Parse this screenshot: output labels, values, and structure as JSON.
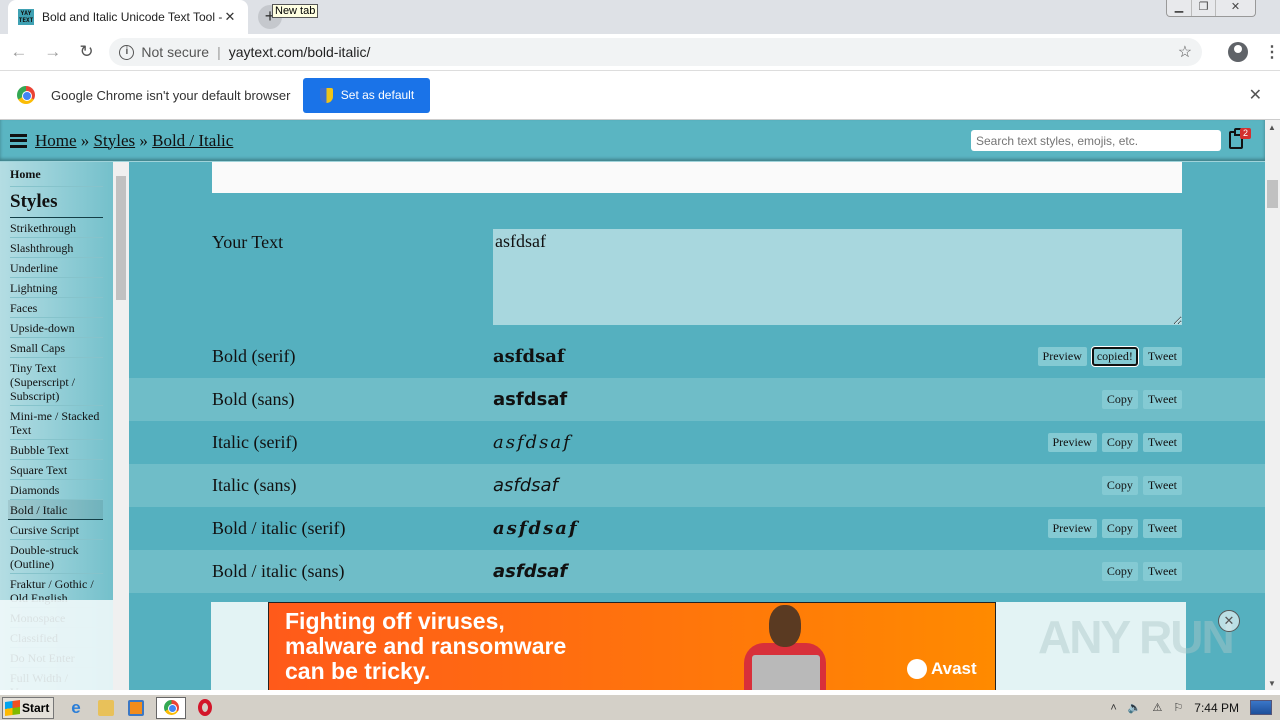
{
  "browser": {
    "tab_title": "Bold and Italic Unicode Text Tool - B",
    "favicon_text": "YAY TEXT",
    "new_tab_tooltip": "New tab",
    "security_label": "Not secure",
    "url": "yaytext.com/bold-italic/",
    "infobar_text": "Google Chrome isn't your default browser",
    "set_default_label": "Set as default"
  },
  "site": {
    "breadcrumb": [
      "Home",
      "Styles",
      "Bold / Italic"
    ],
    "breadcrumb_sep": "»",
    "search_placeholder": "Search text styles, emojis, etc.",
    "clipboard_count": "2"
  },
  "sidebar": {
    "home": "Home",
    "heading": "Styles",
    "items": [
      "Strikethrough",
      "Slashthrough",
      "Underline",
      "Lightning",
      "Faces",
      "Upside-down",
      "Small Caps",
      "Tiny Text (Superscript / Subscript)",
      "Mini-me / Stacked Text",
      "Bubble Text",
      "Square Text",
      "Diamonds",
      "Bold / Italic",
      "Cursive Script",
      "Double-struck (Outline)",
      "Fraktur / Gothic / Old English",
      "Monospace",
      "Classified",
      "Do Not Enter",
      "Full Width / Vaporwave"
    ],
    "active": "Bold / Italic"
  },
  "main": {
    "your_text_label": "Your Text",
    "your_text_value": "asfdsaf",
    "rows": [
      {
        "label": "Bold (serif)",
        "value": "asfdsaf",
        "buttons": [
          "Preview",
          "copied!",
          "Tweet"
        ]
      },
      {
        "label": "Bold (sans)",
        "value": "asfdsaf",
        "buttons": [
          "Copy",
          "Tweet"
        ]
      },
      {
        "label": "Italic (serif)",
        "value": "asfdsaf",
        "buttons": [
          "Preview",
          "Copy",
          "Tweet"
        ]
      },
      {
        "label": "Italic (sans)",
        "value": "asfdsaf",
        "buttons": [
          "Copy",
          "Tweet"
        ]
      },
      {
        "label": "Bold / italic (serif)",
        "value": "asfdsaf",
        "buttons": [
          "Preview",
          "Copy",
          "Tweet"
        ]
      },
      {
        "label": "Bold / italic (sans)",
        "value": "asfdsaf",
        "buttons": [
          "Copy",
          "Tweet"
        ]
      }
    ]
  },
  "ad": {
    "lines": [
      "Fighting off viruses,",
      "malware and ransomware",
      "can be tricky."
    ],
    "brand": "Avast"
  },
  "watermark": "ANY RUN",
  "taskbar": {
    "start_label": "Start",
    "clock": "7:44 PM"
  }
}
